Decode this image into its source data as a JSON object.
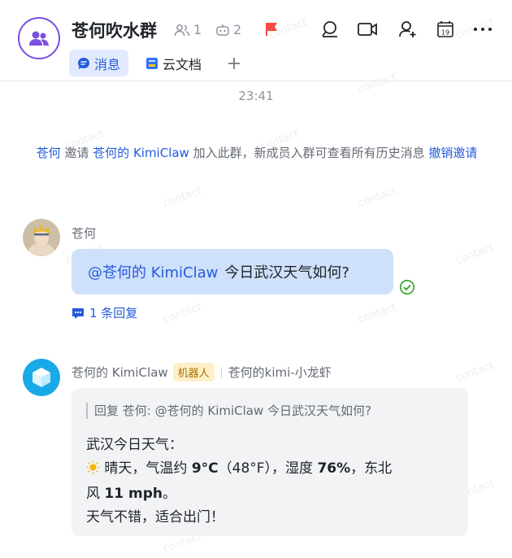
{
  "header": {
    "title": "苍何吹水群",
    "member_count": "1",
    "bot_count": "2",
    "calendar_day": "19"
  },
  "tabs": [
    {
      "label": "消息"
    },
    {
      "label": "云文档"
    }
  ],
  "timestamp": "23:41",
  "system_notice": {
    "inviter": "苍何",
    "verb": " 邀请 ",
    "invitee": "苍何的 KimiClaw",
    "text": " 加入此群，新成员入群可查看所有历史消息 ",
    "revoke": "撤销邀请"
  },
  "message1": {
    "sender": "苍何",
    "mention": "@苍何的 KimiClaw",
    "text": "今日武汉天气如何?",
    "reply_count": "1 条回复"
  },
  "message2": {
    "sender": "苍何的 KimiClaw",
    "badge": "机器人",
    "sub_name": "苍何的kimi-小龙虾",
    "quote": "回复 苍何: @苍何的 KimiClaw 今日武汉天气如何?",
    "line1": "武汉今日天气：",
    "line2_a": " 晴天，气温约 ",
    "line2_temp": "9°C",
    "line2_b": "（48°F），湿度 ",
    "line2_humidity": "76%",
    "line2_c": "，东北",
    "line3_a": "风 ",
    "line3_wind": "11 mph",
    "line3_b": "。",
    "line4": "天气不错，适合出门！"
  },
  "watermark_text": "contact",
  "colors": {
    "accent": "#245bdb",
    "bubble_self": "#cfe0fb",
    "bubble_bot": "#f2f3f5",
    "flag": "#f54a45",
    "read_check": "#2ea121",
    "group_avatar_ring": "#7b4fe0"
  }
}
